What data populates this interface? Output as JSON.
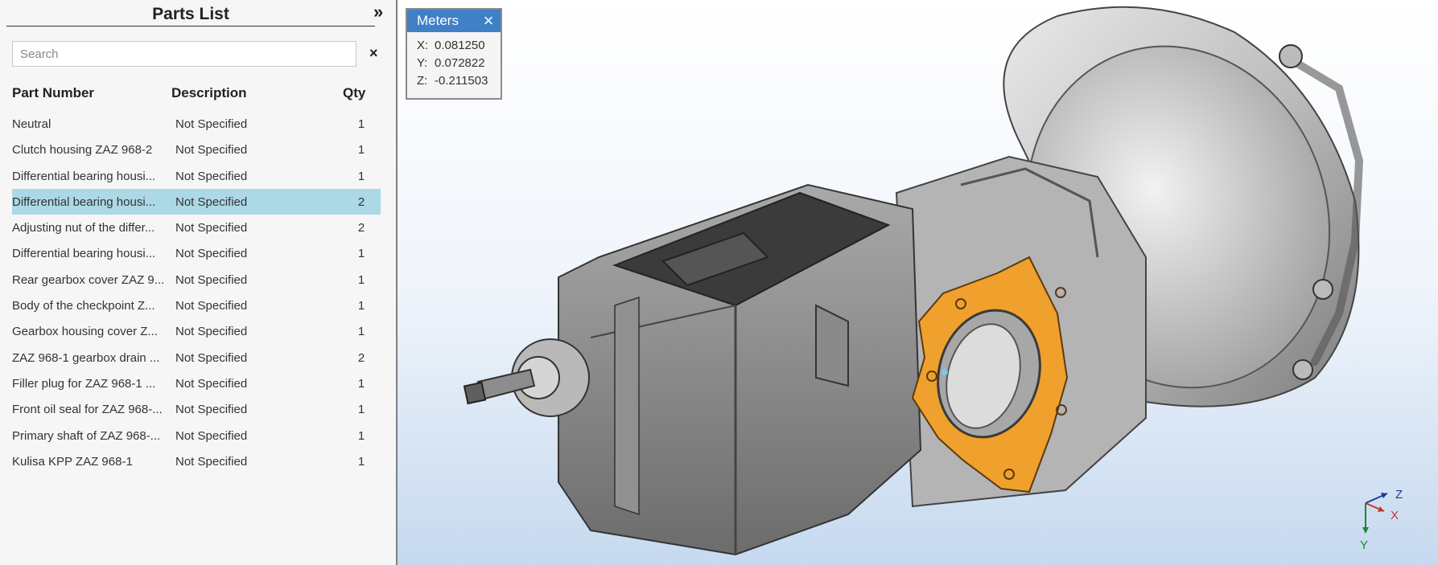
{
  "sidebar": {
    "title": "Parts List",
    "collapse_glyph": "»",
    "search": {
      "placeholder": "Search",
      "value": "",
      "clear_glyph": "×"
    },
    "columns": {
      "part": "Part Number",
      "desc": "Description",
      "qty": "Qty"
    },
    "rows": [
      {
        "part": "Neutral",
        "desc": "Not Specified",
        "qty": "1"
      },
      {
        "part": "Clutch housing ZAZ 968-2",
        "desc": "Not Specified",
        "qty": "1"
      },
      {
        "part": "Differential bearing housi...",
        "desc": "Not Specified",
        "qty": "1"
      },
      {
        "part": "Differential bearing housi...",
        "desc": "Not Specified",
        "qty": "2"
      },
      {
        "part": "Adjusting nut of the differ...",
        "desc": "Not Specified",
        "qty": "2"
      },
      {
        "part": "Differential bearing housi...",
        "desc": "Not Specified",
        "qty": "1"
      },
      {
        "part": "Rear gearbox cover ZAZ 9...",
        "desc": "Not Specified",
        "qty": "1"
      },
      {
        "part": "Body of the checkpoint Z...",
        "desc": "Not Specified",
        "qty": "1"
      },
      {
        "part": "Gearbox housing cover Z...",
        "desc": "Not Specified",
        "qty": "1"
      },
      {
        "part": "ZAZ 968-1 gearbox drain ...",
        "desc": "Not Specified",
        "qty": "2"
      },
      {
        "part": "Filler plug for ZAZ 968-1 ...",
        "desc": "Not Specified",
        "qty": "1"
      },
      {
        "part": "Front oil seal for ZAZ 968-...",
        "desc": "Not Specified",
        "qty": "1"
      },
      {
        "part": "Primary shaft of ZAZ 968-...",
        "desc": "Not Specified",
        "qty": "1"
      },
      {
        "part": "Kulisa KPP ZAZ 968-1",
        "desc": "Not Specified",
        "qty": "1"
      }
    ],
    "selected_row_index": 3,
    "selected_color": "#add8e6"
  },
  "meters": {
    "tab": "Meters",
    "close_glyph": "×",
    "x_label": "X:",
    "x": "0.081250",
    "y_label": "Y:",
    "y": "0.072822",
    "z_label": "Z:",
    "z": "-0.211503",
    "header_color": "#3f80c7"
  },
  "viewport": {
    "model": "gearbox-3d-model",
    "highlight_part_color": "#f0a02c",
    "axes": {
      "x": "X",
      "y": "Y",
      "z": "Z",
      "x_color": "#c0392b",
      "y_color": "#1a8a2e",
      "z_color": "#1f3a8a"
    }
  }
}
